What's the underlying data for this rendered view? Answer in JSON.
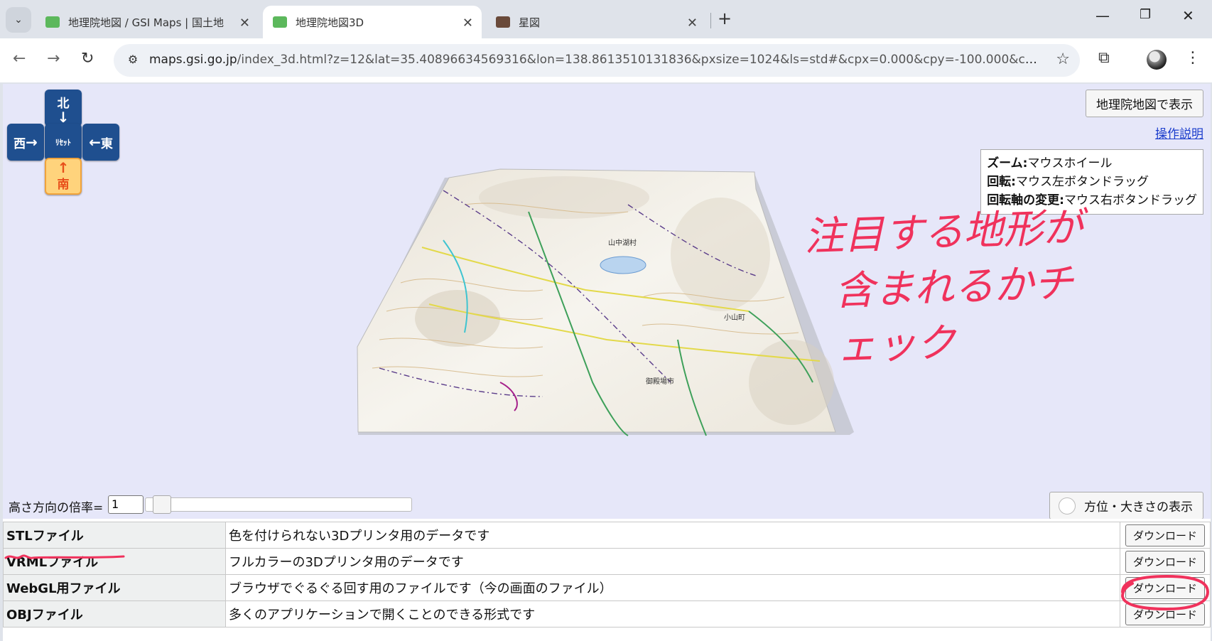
{
  "browser": {
    "tabs": [
      {
        "title": "地理院地図 / GSI Maps | 国土地",
        "active": false
      },
      {
        "title": "地理院地図3D",
        "active": true
      },
      {
        "title": "星図",
        "active": false
      }
    ],
    "url_host": "maps.gsi.go.jp",
    "url_rest": "/index_3d.html?z=12&lat=35.40896634569316&lon=138.8613510131836&pxsize=1024&ls=std#&cpx=0.000&cpy=-100.000&cpz=100...."
  },
  "map3d": {
    "direction_buttons": {
      "north": "北",
      "west": "西",
      "reset": "ﾘｾｯﾄ",
      "east": "東",
      "south": "南"
    },
    "show_in_gsi_button": "地理院地図で表示",
    "help_link": "操作説明",
    "help_box": [
      {
        "key": "ズーム:",
        "value": "マウスホイール"
      },
      {
        "key": "回転:",
        "value": "マウス左ボタンドラッグ"
      },
      {
        "key": "回転軸の変更:",
        "value": "マウス右ボタンドラッグ"
      }
    ],
    "annotation_line1": "注目する地形が",
    "annotation_line2": "含まれるかチェック",
    "height_scale_label": "高さ方向の倍率=",
    "height_scale_value": "1",
    "height_slider_level": 0.03,
    "orientation_button": "方位・大きさの表示",
    "labels": {
      "place1": "山中湖村",
      "place2": "御殿場市",
      "place3": "小山町"
    }
  },
  "downloads": [
    {
      "name": "STLファイル",
      "description": "色を付けられない3Dプリンタ用のデータです",
      "button": "ダウンロード"
    },
    {
      "name": "VRMLファイル",
      "description": "フルカラーの3Dプリンタ用のデータです",
      "button": "ダウンロード"
    },
    {
      "name": "WebGL用ファイル",
      "description": "ブラウザでぐるぐる回す用のファイルです（今の画面のファイル）",
      "button": "ダウンロード"
    },
    {
      "name": "OBJファイル",
      "description": "多くのアプリケーションで開くことのできる形式です",
      "button": "ダウンロード"
    }
  ]
}
